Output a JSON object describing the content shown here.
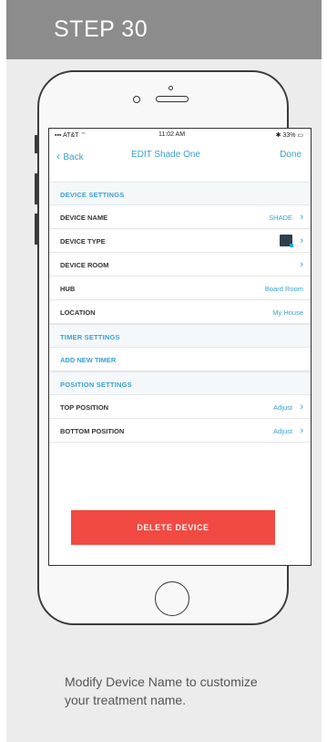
{
  "header": {
    "title": "STEP 30"
  },
  "status_bar": {
    "carrier": "AT&T",
    "time": "11:02 AM",
    "battery": "33%"
  },
  "nav": {
    "back": "Back",
    "title": "EDIT Shade One",
    "done": "Done"
  },
  "sections": {
    "device_settings": "DEVICE SETTINGS",
    "timer_settings": "TIMER SETTINGS",
    "position_settings": "POSITION SETTINGS"
  },
  "rows": {
    "device_name": {
      "label": "DEVICE NAME",
      "value": "SHADE"
    },
    "device_type": {
      "label": "DEVICE TYPE"
    },
    "device_room": {
      "label": "DEVICE ROOM"
    },
    "hub": {
      "label": "HUB",
      "value": "Board Room"
    },
    "location": {
      "label": "LOCATION",
      "value": "My House"
    },
    "add_timer": {
      "label": "ADD NEW TIMER"
    },
    "top_position": {
      "label": "TOP POSITION",
      "value": "Adjust"
    },
    "bottom_position": {
      "label": "BOTTOM POSITION",
      "value": "Adjust"
    }
  },
  "delete_button": "DELETE DEVICE",
  "caption": "Modify Device Name to customize your treatment name.",
  "colors": {
    "accent": "#3aa0cf",
    "danger": "#f04a43",
    "header_bg": "#8c8c8c"
  }
}
